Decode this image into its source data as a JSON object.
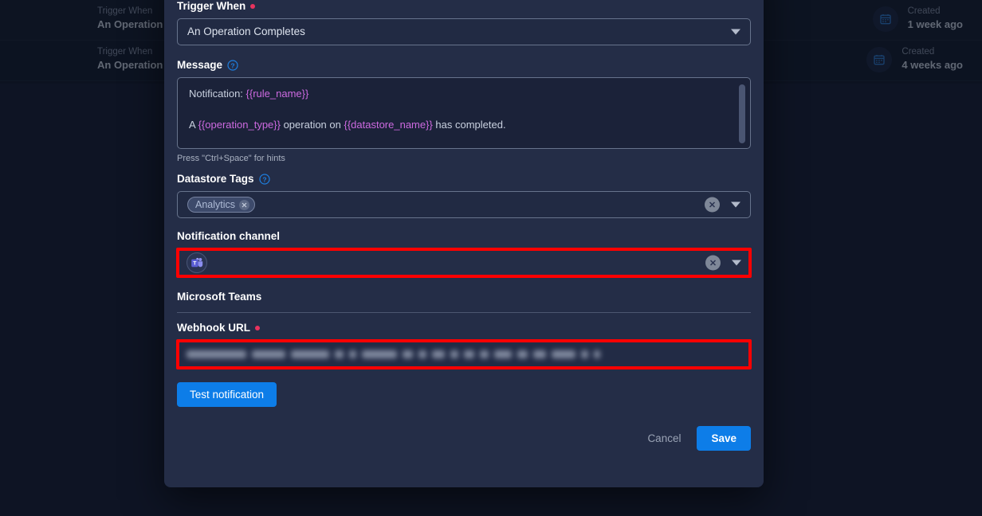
{
  "background": {
    "rows": [
      {
        "trigger_label": "Trigger When",
        "trigger_value": "An Operation Completes",
        "created_label": "Created",
        "created_value": "1 week ago",
        "icon": "calendar-icon"
      },
      {
        "trigger_label": "Trigger When",
        "trigger_value": "An Operation Completes",
        "created_label": "Created",
        "created_value": "4 weeks ago",
        "icon": "calendar-icon"
      }
    ]
  },
  "modal": {
    "trigger_when": {
      "label": "Trigger When",
      "required": true,
      "value": "An Operation Completes",
      "caret_icon": "chevron-down-icon"
    },
    "message": {
      "label": "Message",
      "help_icon": "help-circle-icon",
      "line1_prefix": "Notification: ",
      "line1_token": "{{rule_name}}",
      "line2_a": "A ",
      "line2_token1": "{{operation_type}}",
      "line2_b": " operation on ",
      "line2_token2": "{{datastore_name}}",
      "line2_c": " has completed.",
      "hint": "Press \"Ctrl+Space\" for hints"
    },
    "datastore_tags": {
      "label": "Datastore Tags",
      "help_icon": "help-circle-icon",
      "chips": [
        {
          "label": "Analytics",
          "remove_icon": "close-icon"
        }
      ],
      "clear_icon": "clear-circle-icon",
      "caret_icon": "chevron-down-icon"
    },
    "notification_channel": {
      "label": "Notification channel",
      "selected_icon": "microsoft-teams-icon",
      "clear_icon": "clear-circle-icon",
      "caret_icon": "chevron-down-icon",
      "highlight_color": "#ff0000"
    },
    "provider": {
      "name": "Microsoft Teams"
    },
    "webhook_url": {
      "label": "Webhook URL",
      "required": true,
      "value": "",
      "redacted": true,
      "highlight_color": "#ff0000"
    },
    "test_button": {
      "label": "Test notification"
    },
    "footer": {
      "cancel_label": "Cancel",
      "save_label": "Save"
    }
  },
  "colors": {
    "accent": "#0d7de8",
    "required": "#e8335e",
    "token": "#cd6ae0",
    "modal_bg": "#242d47",
    "page_bg": "#0e1424",
    "highlight": "#ff0000"
  }
}
